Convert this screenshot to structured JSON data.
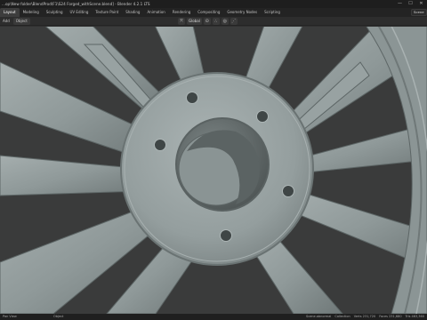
{
  "window": {
    "title": "...op\\New folder\\BlendProd\\F1\\S24 Forged_withScene.blend] - Blender 4.2.1 LTS",
    "controls": [
      "—",
      "☐",
      "✕"
    ]
  },
  "menubar": {
    "tabs": [
      {
        "label": "Layout",
        "active": true
      },
      {
        "label": "Modeling",
        "active": false
      },
      {
        "label": "Sculpting",
        "active": false
      },
      {
        "label": "UV Editing",
        "active": false
      },
      {
        "label": "Texture Paint",
        "active": false
      },
      {
        "label": "Shading",
        "active": false
      },
      {
        "label": "Animation",
        "active": false
      },
      {
        "label": "Rendering",
        "active": false
      },
      {
        "label": "Compositing",
        "active": false
      },
      {
        "label": "Geometry Nodes",
        "active": false
      },
      {
        "label": "Scripting",
        "active": false
      }
    ],
    "scene_label": "Scene"
  },
  "header": {
    "add_label": "Add",
    "mode_label": "Object",
    "orientation_label": "Global"
  },
  "statusbar": {
    "left": "Pan View",
    "mid": "Object",
    "scene": "Scene.abnormal",
    "collection": "Collection",
    "verts": "Verts 231,720",
    "faces": "Faces 231,680",
    "tris": "Tris 463,360"
  },
  "colors": {
    "accent": "#3d3d3d",
    "background": "#303030",
    "metal": "#8e9898"
  }
}
